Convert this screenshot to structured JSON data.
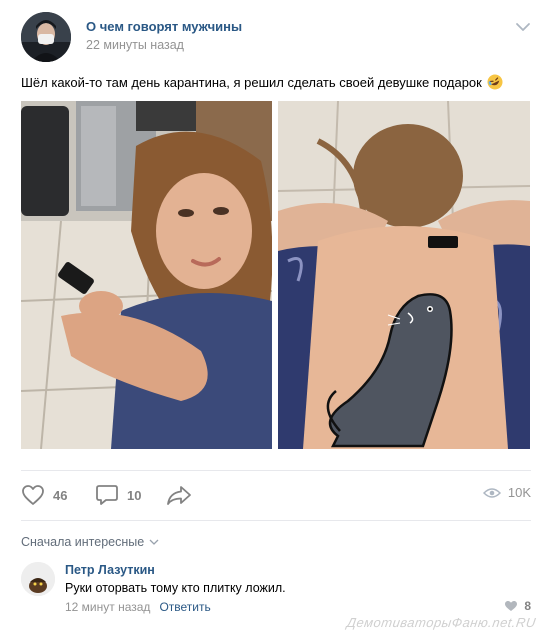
{
  "post": {
    "author": "О чем говорят мужчины",
    "time": "22 минуты назад",
    "text": "Шёл какой-то там день карантина, я решил сделать своей девушке подарок",
    "emoji_icon": "rofl-emoji-icon"
  },
  "photos": [
    {
      "name": "photo-girl-with-phone"
    },
    {
      "name": "photo-seal-drawing-on-back"
    }
  ],
  "actions": {
    "likes": "46",
    "comments": "10",
    "views": "10K"
  },
  "comments_section": {
    "sort_label": "Сначала интересные",
    "items": [
      {
        "author": "Петр Лазуткин",
        "text": "Руки оторвать тому кто плитку ложил.",
        "time": "12 минут назад",
        "reply_label": "Ответить",
        "likes": "8"
      }
    ]
  },
  "watermark": "ДемотиваторыФаню.net.RU",
  "colors": {
    "link": "#2a5885",
    "meta": "#939393",
    "icon": "#828282",
    "divider": "#e7e8ec"
  }
}
